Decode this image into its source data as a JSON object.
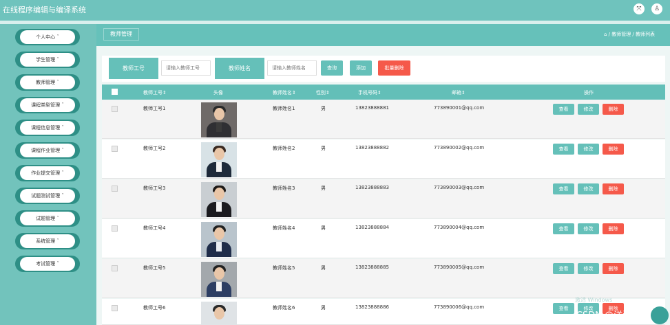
{
  "app": {
    "title": "在线程序编辑与编译系统",
    "fullscreen_icon": "fullscreen-icon",
    "user_icon": "user-icon"
  },
  "sidebar": {
    "items": [
      {
        "label": "个人中心 ˇ"
      },
      {
        "label": "学生管理 ˇ"
      },
      {
        "label": "教师管理 ˇ"
      },
      {
        "label": "课程类型管理 ˇ"
      },
      {
        "label": "课程信息管理 ˇ"
      },
      {
        "label": "课程作业管理 ˇ"
      },
      {
        "label": "作业提交管理 ˇ"
      },
      {
        "label": "试题测试管理 ˇ"
      },
      {
        "label": "试题管理 ˇ"
      },
      {
        "label": "系统管理 ˇ"
      },
      {
        "label": "考试管理 ˇ"
      }
    ]
  },
  "header": {
    "tab": "教师管理",
    "breadcrumb": "⌂ / 教师管理 / 教师列表"
  },
  "search": {
    "teacher_no_label": "教师工号",
    "teacher_no_placeholder": "请输入教师工号",
    "teacher_name_label": "教师姓名",
    "teacher_name_placeholder": "请输入教师姓名",
    "search_button": "查询",
    "add_button": "添加",
    "batch_delete_button": "批量删除"
  },
  "table": {
    "columns": [
      "教师工号⇕",
      "头像",
      "教师姓名⇕",
      "性别⇕",
      "手机号码⇕",
      "邮箱⇕",
      "操作"
    ],
    "rows": [
      {
        "no": "教师工号1",
        "name": "教师姓名1",
        "gender": "男",
        "phone": "13823888881",
        "email": "773890001@qq.com"
      },
      {
        "no": "教师工号2",
        "name": "教师姓名2",
        "gender": "男",
        "phone": "13823888882",
        "email": "773890002@qq.com"
      },
      {
        "no": "教师工号3",
        "name": "教师姓名3",
        "gender": "男",
        "phone": "13823888883",
        "email": "773890003@qq.com"
      },
      {
        "no": "教师工号4",
        "name": "教师姓名4",
        "gender": "男",
        "phone": "13823888884",
        "email": "773890004@qq.com"
      },
      {
        "no": "教师工号5",
        "name": "教师姓名5",
        "gender": "男",
        "phone": "13823888885",
        "email": "773890005@qq.com"
      },
      {
        "no": "教师工号6",
        "name": "教师姓名6",
        "gender": "男",
        "phone": "13823888886",
        "email": "773890006@qq.com"
      }
    ],
    "actions": {
      "view": "查看",
      "edit": "修改",
      "delete": "删除"
    }
  },
  "overlay": {
    "watermark": "CSDN @洋洋学姐",
    "windows_text": "激活 Windows"
  },
  "colors": {
    "primary": "#65c0b9",
    "danger": "#f5594a",
    "sidebar": "#72c3bc"
  }
}
